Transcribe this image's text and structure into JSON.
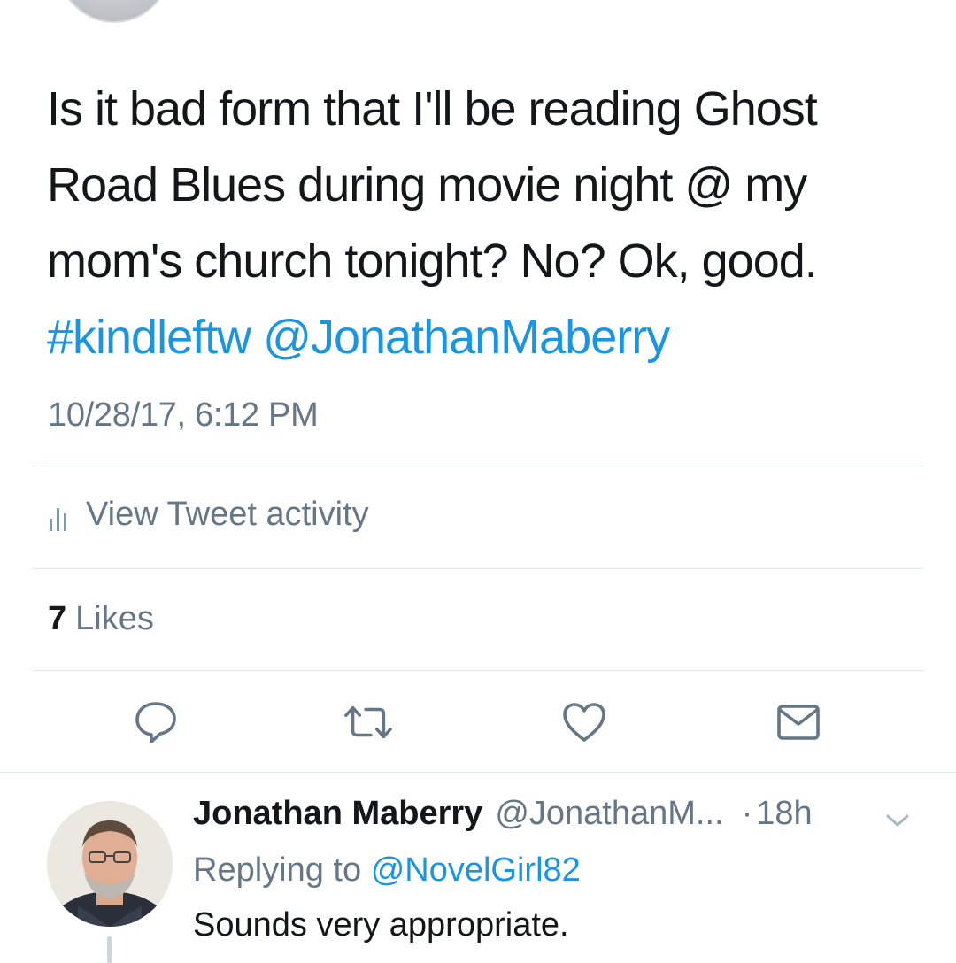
{
  "tweet": {
    "text_lines": [
      "Is it bad form that I'll be reading Ghost",
      "Road Blues during movie night @ my",
      "mom's church tonight? No? Ok, good."
    ],
    "hashtag": "#kindleftw",
    "mention": "@JonathanMaberry",
    "timestamp": "10/28/17, 6:12 PM"
  },
  "activity": {
    "label": "View Tweet activity",
    "icon": "bar-chart-icon"
  },
  "stats": {
    "likes_count": "7",
    "likes_label": "Likes"
  },
  "actions": {
    "reply_icon": "reply-icon",
    "retweet_icon": "retweet-icon",
    "like_icon": "heart-icon",
    "dm_icon": "envelope-icon"
  },
  "reply": {
    "name": "Jonathan Maberry",
    "handle": "@JonathanM...",
    "separator": "·",
    "time": "18h",
    "replying_prefix": "Replying to",
    "replying_to": "@NovelGirl82",
    "text": "Sounds very appropriate."
  },
  "colors": {
    "link": "#1b95e0",
    "secondary_text": "#657786",
    "primary_text": "#14171a",
    "divider": "#e1e8ed"
  }
}
